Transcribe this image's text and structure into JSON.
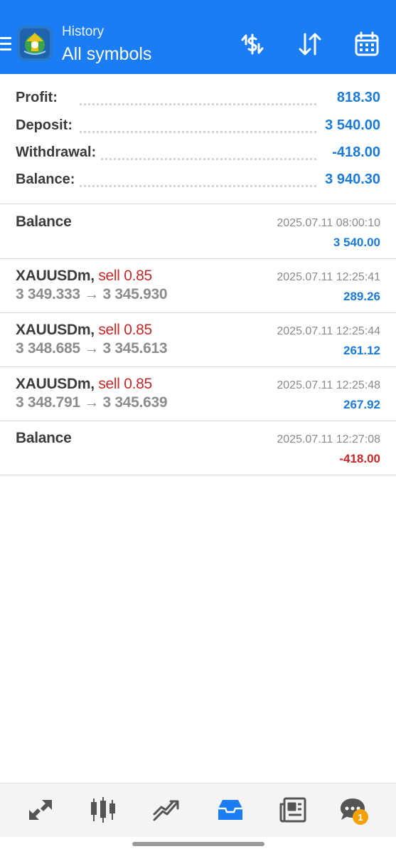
{
  "header": {
    "subtitle": "History",
    "title": "All symbols",
    "background": "#1a7df3",
    "icons": [
      "menu-icon",
      "app-logo",
      "currency-exchange-icon",
      "sort-icon",
      "calendar-icon"
    ]
  },
  "summary": {
    "rows": [
      {
        "label": "Profit:",
        "value": "818.30"
      },
      {
        "label": "Deposit:",
        "value": "3 540.00"
      },
      {
        "label": "Withdrawal:",
        "value": "-418.00"
      },
      {
        "label": "Balance:",
        "value": "3 940.30"
      }
    ]
  },
  "entries": [
    {
      "title": "Balance",
      "time": "2025.07.11 08:00:10",
      "amount": "3 540.00"
    },
    {
      "symbol": "XAUUSDm,",
      "side": "sell 0.85",
      "prices": "3 349.333 → 3 345.930",
      "time": "2025.07.11 12:25:41",
      "amount": "289.26"
    },
    {
      "symbol": "XAUUSDm,",
      "side": "sell 0.85",
      "prices": "3 348.685 → 3 345.613",
      "time": "2025.07.11 12:25:44",
      "amount": "261.12"
    },
    {
      "symbol": "XAUUSDm,",
      "side": "sell 0.85",
      "prices": "3 348.791 → 3 345.639",
      "time": "2025.07.11 12:25:48",
      "amount": "267.92"
    },
    {
      "title": "Balance",
      "time": "2025.07.11 12:27:08",
      "amount": "-418.00"
    }
  ],
  "colors": {
    "positive": "#1a7ad8",
    "negative": "#c62828",
    "accent": "#1a7df3",
    "badge": "#f5a20a"
  },
  "bottom_nav": {
    "items": [
      "quotes-icon",
      "chart-icon",
      "trade-icon",
      "history-icon",
      "news-icon",
      "messages-icon"
    ],
    "active": "history-icon",
    "badge_count": "1"
  }
}
